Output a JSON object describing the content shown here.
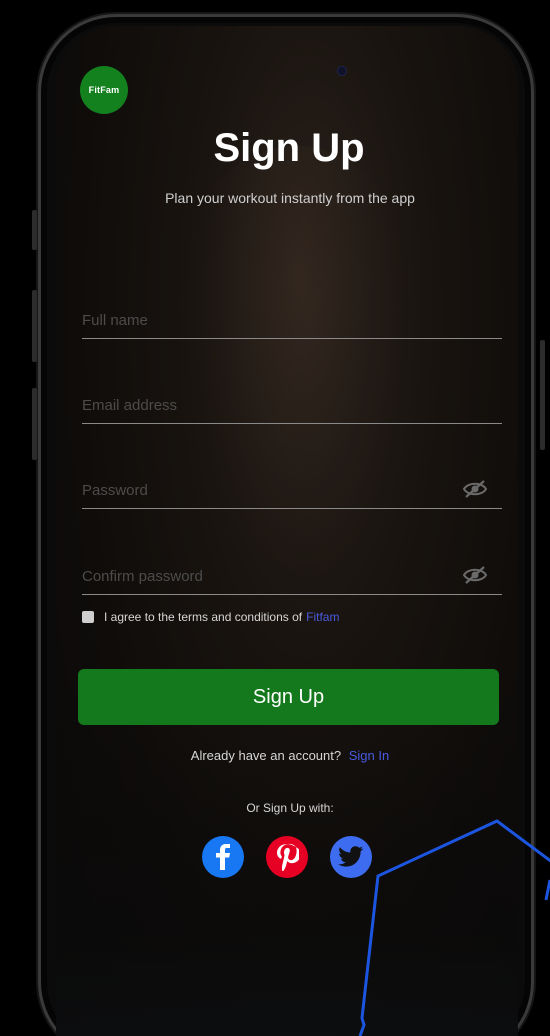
{
  "logo_text": "FitFam",
  "title": "Sign Up",
  "subtitle": "Plan your  workout instantly from the app",
  "fields": {
    "full_name_placeholder": "Full name",
    "email_placeholder": "Email address",
    "password_placeholder": "Password",
    "confirm_password_placeholder": "Confirm password"
  },
  "terms": {
    "text": "I agree to the terms and conditions of",
    "link": "Fitfam"
  },
  "primary_button": "Sign Up",
  "signin": {
    "prompt": "Already have an account?",
    "link": "Sign In"
  },
  "social": {
    "label": "Or Sign Up with:",
    "providers": [
      "facebook-icon",
      "pinterest-icon",
      "twitter-icon"
    ]
  },
  "colors": {
    "brand_green": "#14791c",
    "link_blue": "#4a5ae0",
    "facebook": "#1877f2",
    "pinterest": "#e60023",
    "twitter": "#3d6cf0"
  }
}
